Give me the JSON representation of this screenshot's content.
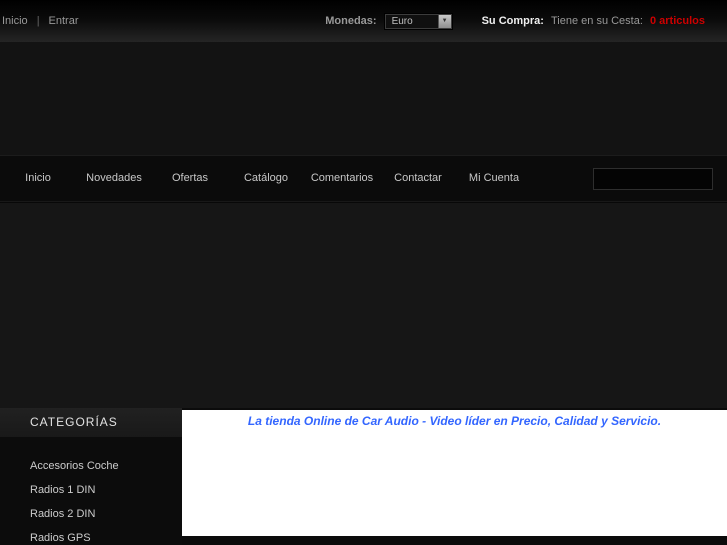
{
  "topbar": {
    "links": [
      {
        "label": "Inicio"
      },
      {
        "label": "Entrar"
      }
    ],
    "separator": "|",
    "currency_label": "Monedas:",
    "currency_value": "Euro",
    "cart_label": "Su Compra:",
    "cart_text": "Tiene en su Cesta:",
    "cart_count": "0 articulos"
  },
  "nav": {
    "items": [
      "Inicio",
      "Novedades",
      "Ofertas",
      "Catálogo",
      "Comentarios",
      "Contactar",
      "Mi Cuenta"
    ],
    "search_value": "",
    "search_placeholder": ""
  },
  "sidebar": {
    "title": "CATEGORÍAS",
    "items": [
      "Accesorios Coche",
      "Radios 1 DIN",
      "Radios 2 DIN",
      "Radios GPS"
    ]
  },
  "main": {
    "tagline": "La tienda Online de Car Audio - Video líder en Precio, Calidad y Servicio."
  },
  "colors": {
    "accent_blue": "#3366ff",
    "cart_red": "#cc0000",
    "page_dark": "#131313"
  }
}
